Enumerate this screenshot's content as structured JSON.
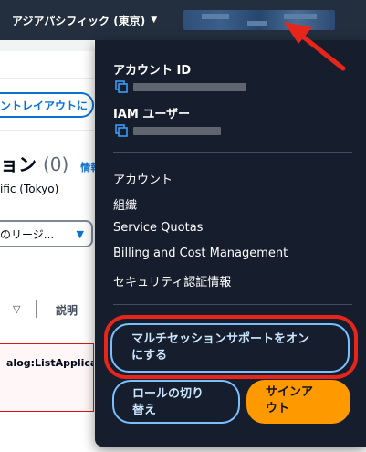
{
  "topbar": {
    "region_label": "アジアパシフィック (東京)",
    "region_caret": "▼"
  },
  "background_page": {
    "layout_button_label": "ントレイアウトに",
    "heading_suffix": "ョン",
    "heading_count": "(0)",
    "info_link": "情報",
    "region_text": "ific (Tokyo)",
    "region_select_value": "のリージ...",
    "region_select_caret": "▼",
    "column_caret": "▽",
    "column_label": "説明",
    "error_text": "alog:ListApplicat"
  },
  "dropdown": {
    "account_id_label": "アカウント ID",
    "iam_user_label": "IAM ユーザー",
    "menu_items": [
      "アカウント",
      "組織",
      "Service Quotas",
      "Billing and Cost Management",
      "セキュリティ認証情報"
    ],
    "multisession_button": {
      "line1": "マルチセッションサポートをオン",
      "line2": "にする"
    },
    "switch_role_button": {
      "line1": "ロールの切り",
      "line2": "替え"
    },
    "signout_button": {
      "line1": "サインア",
      "line2": "ウト"
    }
  },
  "colors": {
    "topbar_bg": "#232f3e",
    "dropdown_bg": "#161e2d",
    "link_blue": "#0972d3",
    "button_outline": "#7abfff",
    "signout_orange": "#ff9900",
    "annotation_red": "#e8251a"
  },
  "icons": {
    "copy": "copy-icon",
    "caret": "caret-down-icon",
    "annotation": "red-arrow-icon"
  }
}
